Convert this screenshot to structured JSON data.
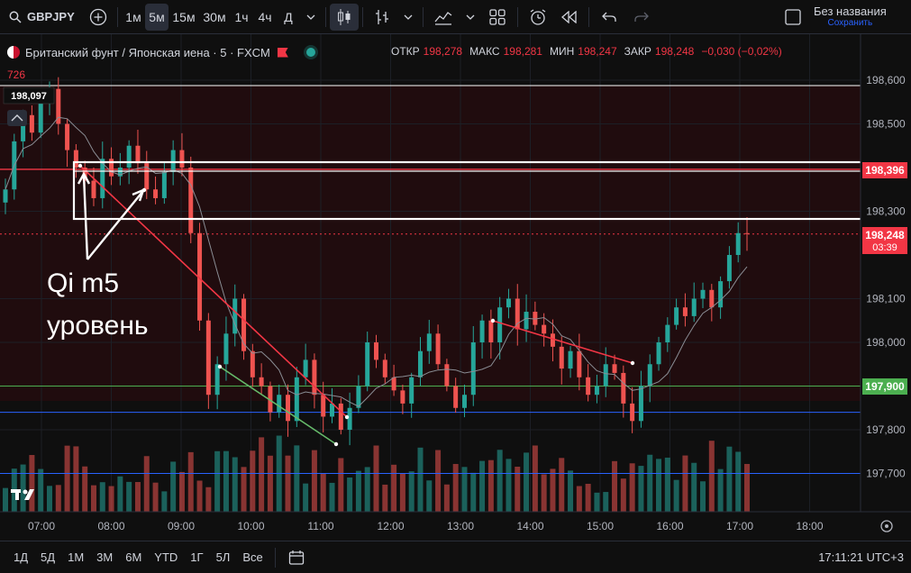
{
  "toolbar": {
    "symbol": "GBPJPY",
    "intervals": [
      "1м",
      "5м",
      "15м",
      "30м",
      "1ч",
      "4ч",
      "Д"
    ],
    "active_interval": "5м",
    "layout_title": "Без названия",
    "layout_status": "Сохранить"
  },
  "legend": {
    "instrument": "Британский фунт / Японская иена · 5 · FXCM",
    "volume_value": "726",
    "open_label": "ОТКР",
    "open": "198,278",
    "high_label": "МАКС",
    "high": "198,281",
    "low_label": "МИН",
    "low": "198,247",
    "close_label": "ЗАКР",
    "close": "198,248",
    "change": "−0,030 (−0,02%)"
  },
  "price_axis": {
    "ticks": [
      "198,600",
      "198,500",
      "198,300",
      "198,100",
      "198,000",
      "197,800",
      "197,700"
    ],
    "level_red": "198,396",
    "current_price": "198,248",
    "countdown": "03:39",
    "level_green": "197,900",
    "hover_price": "198,097"
  },
  "time_axis": {
    "ticks": [
      "07:00",
      "08:00",
      "09:00",
      "10:00",
      "11:00",
      "12:00",
      "13:00",
      "14:00",
      "15:00",
      "16:00",
      "17:00",
      "18:00"
    ]
  },
  "annotation": {
    "line1": "Qi m5",
    "line2": "уровень"
  },
  "bottom": {
    "ranges": [
      "1Д",
      "5Д",
      "1М",
      "3М",
      "6М",
      "YTD",
      "1Г",
      "5Л",
      "Все"
    ],
    "clock": "17:11:21 UTC+3"
  },
  "colors": {
    "up": "#26a69a",
    "down": "#ef5350",
    "accent_red": "#f23645",
    "green_level": "#4caf50",
    "blue_level": "#2962ff"
  },
  "chart_data": {
    "type": "candlestick",
    "time_range": [
      "06:30",
      "18:30"
    ],
    "ylim": [
      197.62,
      198.68
    ],
    "levels": [
      {
        "price": 198.396,
        "color": "red"
      },
      {
        "price": 198.248,
        "color": "red-dotted"
      },
      {
        "price": 197.9,
        "color": "green"
      },
      {
        "price": 197.84,
        "color": "blue"
      },
      {
        "price": 197.7,
        "color": "blue"
      }
    ],
    "zone": {
      "top": 198.415,
      "bottom": 198.28
    },
    "closes": [
      198.35,
      198.46,
      198.52,
      198.48,
      198.55,
      198.58,
      198.5,
      198.44,
      198.4,
      198.37,
      198.33,
      198.42,
      198.38,
      198.4,
      198.45,
      198.41,
      198.35,
      198.33,
      198.39,
      198.44,
      198.4,
      198.25,
      198.05,
      197.88,
      197.95,
      198.02,
      198.1,
      197.98,
      197.92,
      197.9,
      197.84,
      197.88,
      197.82,
      197.92,
      197.96,
      197.88,
      197.83,
      197.86,
      197.8,
      197.85,
      197.9,
      198.0,
      197.96,
      197.92,
      197.89,
      197.86,
      197.92,
      197.98,
      198.02,
      197.95,
      197.9,
      197.85,
      197.88,
      198.0,
      198.05,
      198.0,
      198.08,
      198.1,
      198.03,
      198.07,
      198.04,
      198.02,
      197.99,
      197.94,
      197.98,
      197.92,
      197.88,
      197.9,
      197.95,
      197.93,
      197.86,
      197.82,
      197.9,
      197.95,
      198.0,
      198.04,
      198.08,
      198.06,
      198.1,
      198.12,
      198.08,
      198.14,
      198.2,
      198.25,
      198.248
    ]
  }
}
